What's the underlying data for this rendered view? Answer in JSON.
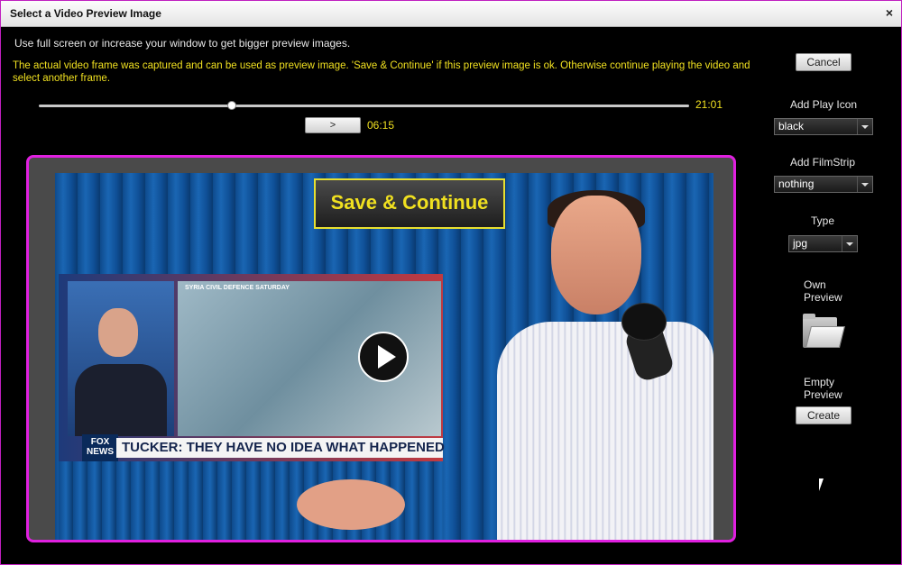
{
  "window": {
    "title": "Select a Video Preview Image",
    "close_glyph": "×"
  },
  "hint": "Use full screen or increase your window to get bigger preview images.",
  "info": "The actual video frame was captured and can be used as preview image. 'Save & Continue' if this preview image is ok. Otherwise continue playing the video and select another frame.",
  "player": {
    "duration": "21:01",
    "current_time": "06:15",
    "position_fraction": 0.297,
    "play_label": ">"
  },
  "preview": {
    "save_label": "Save & Continue",
    "tv_banner": "TUCKER: THEY HAVE NO IDEA WHAT HAPPENED",
    "tv_logo": "FOX NEWS",
    "tv_corner_label": "SYRIA CIVIL DEFENCE SATURDAY"
  },
  "sidebar": {
    "cancel_label": "Cancel",
    "play_icon_label": "Add Play Icon",
    "play_icon_value": "black",
    "filmstrip_label": "Add FilmStrip",
    "filmstrip_value": "nothing",
    "type_label": "Type",
    "type_value": "jpg",
    "own_preview_label_1": "Own",
    "own_preview_label_2": "Preview",
    "empty_preview_label_1": "Empty",
    "empty_preview_label_2": "Preview",
    "create_label": "Create"
  },
  "colors": {
    "accent_yellow": "#f0e020",
    "border_magenta": "#e020e0"
  }
}
